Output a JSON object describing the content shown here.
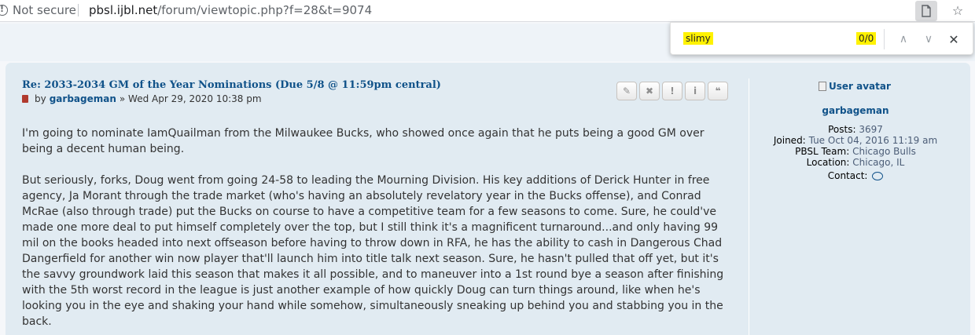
{
  "browser": {
    "security_label": "Not secure",
    "url_domain": "pbsl.ijbl.net",
    "url_path": "/forum/viewtopic.php?f=28&t=9074",
    "star_glyph": "☆"
  },
  "findbar": {
    "query": "slimy",
    "count": "0/0",
    "up_glyph": "∧",
    "down_glyph": "∨",
    "close_glyph": "✕"
  },
  "post": {
    "title": "Re: 2033-2034 GM of the Year Nominations (Due 5/8 @ 11:59pm central)",
    "by_label": "by",
    "author": "garbageman",
    "date": "» Wed Apr 29, 2020 10:38 pm",
    "actions": [
      {
        "name": "edit",
        "glyph": "✎"
      },
      {
        "name": "delete",
        "glyph": "✖"
      },
      {
        "name": "report",
        "glyph": "!"
      },
      {
        "name": "info",
        "glyph": "i"
      },
      {
        "name": "quote",
        "glyph": "❝"
      }
    ],
    "paragraphs": [
      "I'm going to nominate IamQuailman from the Milwaukee Bucks, who showed once again that he puts being a good GM over being a decent human being.",
      "But seriously, forks, Doug went from going 24-58 to leading the Mourning Division. His key additions of Derick Hunter in free agency, Ja Morant through the trade market (who's having an absolutely revelatory year in the Bucks offense), and Conrad McRae (also through trade) put the Bucks on course to have a competitive team for a few seasons to come. Sure, he could've made one more deal to put himself completely over the top, but I still think it's a magnificent turnaround...and only having 99 mil on the books headed into next offseason before having to throw down in RFA, he has the ability to cash in Dangerous Chad Dangerfield for another win now player that'll launch him into title talk next season. Sure, he hasn't pulled that off yet, but it's the savvy groundwork laid this season that makes it all possible, and to maneuver into a 1st round bye a season after finishing with the 5th worst record in the league is just another example of how quickly Doug can turn things around, like when he's looking you in the eye and shaking your hand while somehow, simultaneously sneaking up behind you and stabbing you in the back."
    ]
  },
  "profile": {
    "avatar_alt": "User avatar",
    "name": "garbageman",
    "posts_label": "Posts:",
    "posts_value": "3697",
    "joined_label": "Joined:",
    "joined_value": "Tue Oct 04, 2016 11:19 am",
    "team_label": "PBSL Team:",
    "team_value": "Chicago Bulls",
    "location_label": "Location:",
    "location_value": "Chicago, IL",
    "contact_label": "Contact:"
  }
}
